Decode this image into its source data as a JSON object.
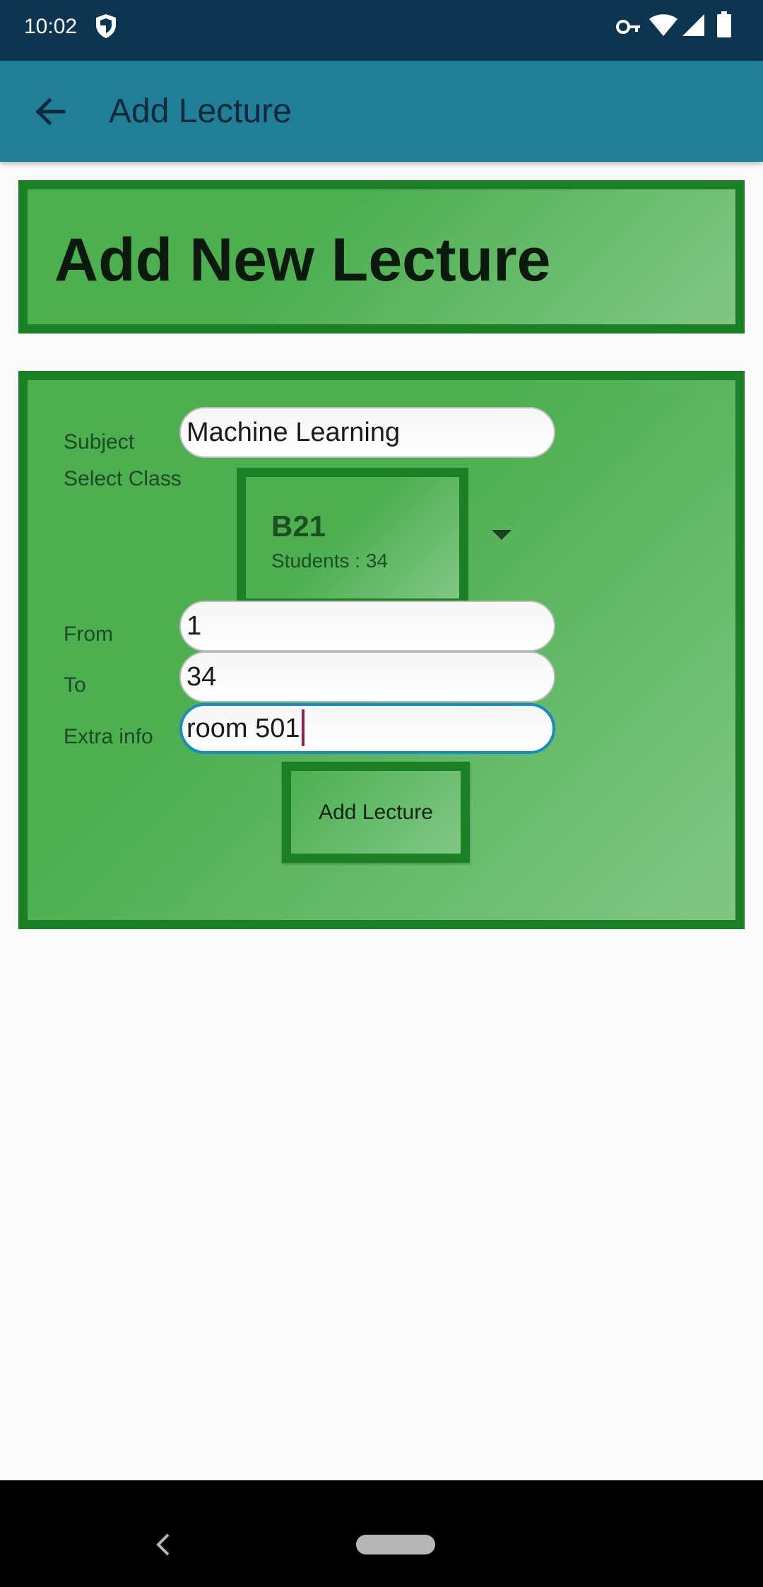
{
  "status_bar": {
    "time": "10:02",
    "icons": [
      "shield-icon",
      "vpn-key-icon",
      "wifi-icon",
      "signal-icon",
      "battery-icon"
    ]
  },
  "app_bar": {
    "back_icon": "arrow-left-icon",
    "title": "Add Lecture",
    "color": "#217e98"
  },
  "header": {
    "title": "Add New Lecture"
  },
  "form": {
    "subject_label": "Subject",
    "subject_value": "Machine Learning",
    "select_class_label": "Select Class",
    "selected_class": {
      "name": "B21",
      "students": "Students : 34"
    },
    "from_label": "From",
    "from_value": "1",
    "to_label": "To",
    "to_value": "34",
    "extra_info_label": "Extra info",
    "extra_info_value": "room 501",
    "submit_label": "Add Lecture"
  },
  "colors": {
    "card_border": "#1b7f26",
    "card_fill": "#4caf50",
    "focus_accent": "#1a8bc0",
    "caret": "#9c1a54"
  },
  "nav_bar": {
    "icons": [
      "nav-back-icon",
      "nav-home-pill"
    ]
  }
}
